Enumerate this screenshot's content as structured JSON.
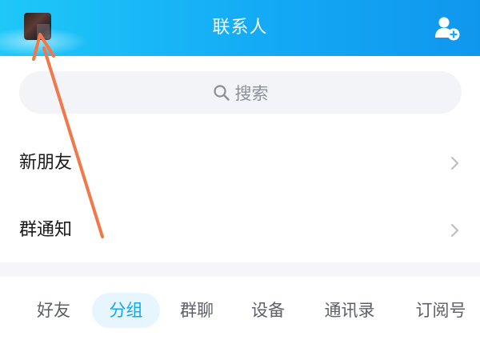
{
  "header": {
    "title": "联系人",
    "avatar_icon": "avatar",
    "add_contact_icon": "add-contact-icon"
  },
  "search": {
    "placeholder": "搜索",
    "icon": "search-icon"
  },
  "rows": [
    {
      "label": "新朋友",
      "icon": "chevron-right-icon"
    },
    {
      "label": "群通知",
      "icon": "chevron-right-icon"
    }
  ],
  "tabs": [
    {
      "label": "好友",
      "active": false
    },
    {
      "label": "分组",
      "active": true
    },
    {
      "label": "群聊",
      "active": false
    },
    {
      "label": "设备",
      "active": false
    },
    {
      "label": "通讯录",
      "active": false
    },
    {
      "label": "订阅号",
      "active": false
    }
  ],
  "colors": {
    "header_start": "#1ec8f8",
    "header_end": "#0f97ee",
    "accent": "#12a6f2",
    "active_tab_bg": "#e7f6fe",
    "annotation_arrow": "#f0784a"
  }
}
